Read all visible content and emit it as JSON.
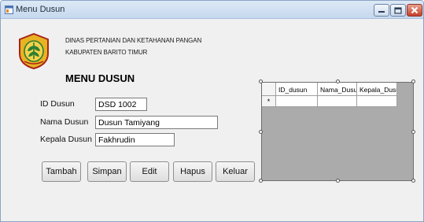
{
  "window": {
    "title": "Menu Dusun",
    "icon": "form-icon",
    "controls": [
      "minimize-icon",
      "maximize-icon",
      "close-icon"
    ]
  },
  "header": {
    "logo": "kabupaten-emblem-icon",
    "org_line1": "DINAS PERTANIAN DAN KETAHANAN PANGAN",
    "org_line2": "KABUPATEN BARITO TIMUR",
    "title": "MENU DUSUN"
  },
  "form": {
    "id_label": "ID Dusun",
    "id_value": "DSD 1002",
    "nama_label": "Nama Dusun",
    "nama_value": "Dusun Tamiyang",
    "kepala_label": "Kepala Dusun",
    "kepala_value": "Fakhrudin"
  },
  "buttons": {
    "tambah": "Tambah",
    "simpan": "Simpan",
    "edit": "Edit",
    "hapus": "Hapus",
    "keluar": "Keluar"
  },
  "grid": {
    "columns": [
      "ID_dusun",
      "Nama_Dusun",
      "Kepala_Dusun"
    ],
    "new_row_marker": "*",
    "rows": []
  },
  "colors": {
    "title_bar": "#c6d8ee",
    "close_button": "#c6402a",
    "grid_background": "#ababab",
    "form_background": "#f0f0f0"
  }
}
